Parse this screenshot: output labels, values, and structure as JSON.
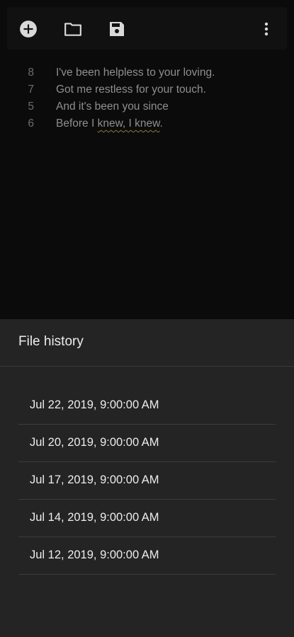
{
  "toolbar": {
    "icons": [
      "add-circle-icon",
      "folder-icon",
      "save-icon",
      "more-vert-icon"
    ]
  },
  "editor": {
    "lines": [
      {
        "num": "8",
        "text": "I've been helpless to your loving."
      },
      {
        "num": "7",
        "text": "Got me restless for your touch."
      },
      {
        "num": "5",
        "text": "And it's been you since"
      },
      {
        "num": "6",
        "text_before": "Before I ",
        "text_flagged": "knew, I knew",
        "text_after": "."
      }
    ]
  },
  "file_history": {
    "title": "File history",
    "entries": [
      "Jul 22, 2019, 9:00:00 AM",
      "Jul 20, 2019, 9:00:00 AM",
      "Jul 17, 2019, 9:00:00 AM",
      "Jul 14, 2019, 9:00:00 AM",
      "Jul 12, 2019, 9:00:00 AM"
    ]
  },
  "colors": {
    "background": "#0b0b0b",
    "sheet": "#242424",
    "icon": "#d9d9d9"
  }
}
